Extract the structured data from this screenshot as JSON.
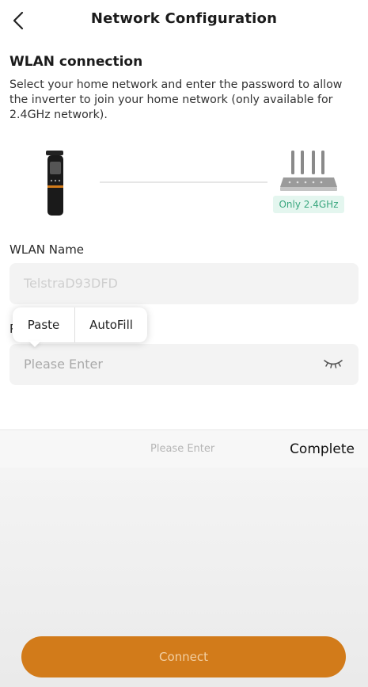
{
  "header": {
    "title": "Network Configuration",
    "back_icon": "chevron-left-icon"
  },
  "wlan_section": {
    "title": "WLAN connection",
    "description": "Select your home network and enter the password to allow the inverter to join your home network (only available for 2.4GHz network).",
    "band_badge": "Only 2.4GHz",
    "device_icon": "wifi-dongle-icon",
    "router_icon": "router-icon"
  },
  "wlan_name": {
    "label": "WLAN Name",
    "value": "TelstraD93DFD"
  },
  "password": {
    "label": "P",
    "placeholder": "Please Enter",
    "toggle_icon": "eye-closed-icon"
  },
  "context_menu": {
    "items": [
      "Paste",
      "AutoFill"
    ]
  },
  "keyboard_bar": {
    "placeholder": "Please Enter",
    "done_label": "Complete"
  },
  "connect_button": {
    "label": "Connect"
  },
  "colors": {
    "accent": "#d27b1a",
    "badge_bg": "#e4f6ef",
    "badge_text": "#3aa77f"
  }
}
